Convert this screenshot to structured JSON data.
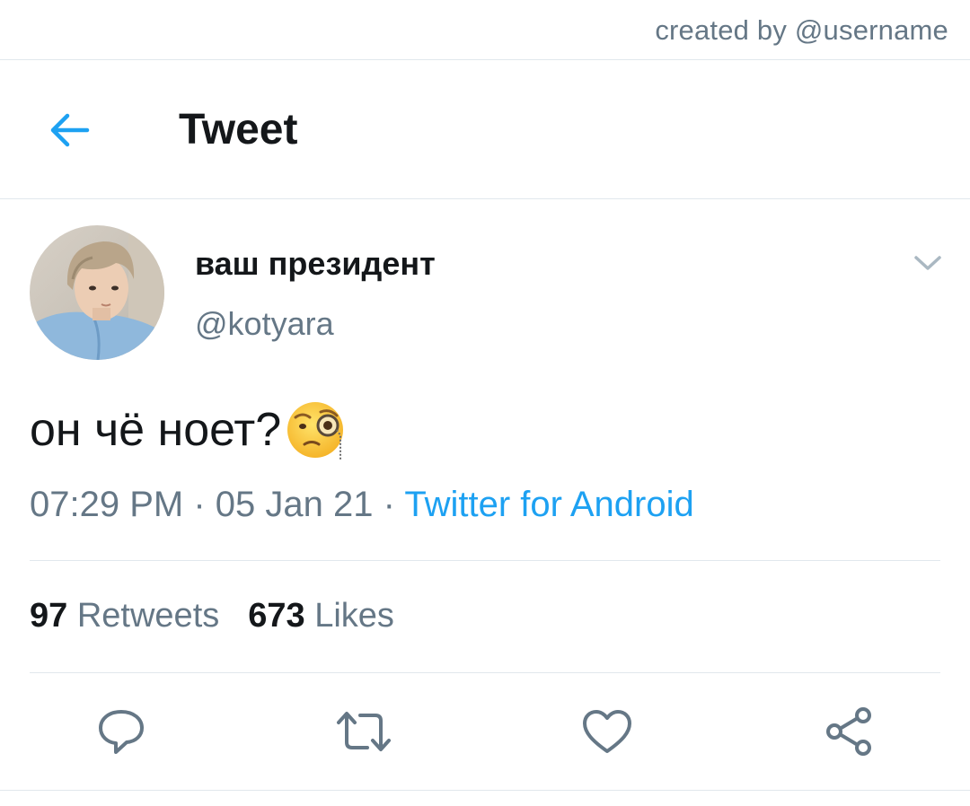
{
  "credit": {
    "text": "created by @username"
  },
  "header": {
    "title": "Tweet",
    "back_icon": "arrow-left-icon"
  },
  "author": {
    "display_name": "ваш президент",
    "handle": "@kotyara",
    "more_icon": "chevron-down-icon"
  },
  "tweet": {
    "text": "он чё ноет?",
    "emoji": "face-with-monocle-emoji",
    "time": "07:29 PM",
    "date": "05 Jan 21",
    "separator": "·",
    "source": "Twitter for Android"
  },
  "stats": {
    "retweets_count": "97",
    "retweets_label": "Retweets",
    "likes_count": "673",
    "likes_label": "Likes"
  },
  "actions": {
    "reply_icon": "reply-icon",
    "retweet_icon": "retweet-icon",
    "like_icon": "heart-icon",
    "share_icon": "share-icon"
  },
  "colors": {
    "accent": "#1da1f2",
    "text_primary": "#14171a",
    "text_secondary": "#657786",
    "divider": "#e1e8ed"
  }
}
